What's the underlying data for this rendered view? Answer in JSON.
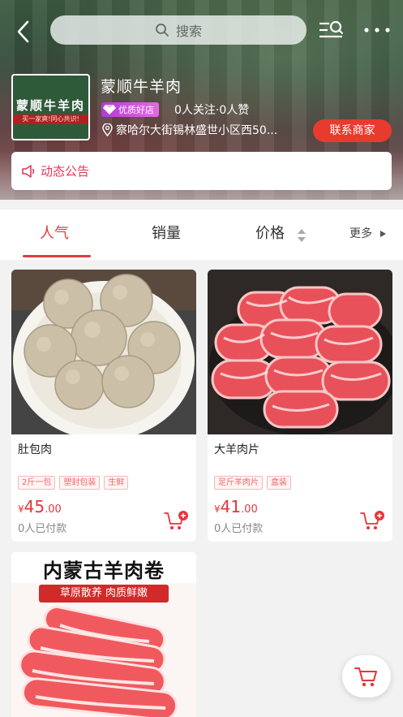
{
  "header": {
    "search_placeholder": "搜索",
    "icons": {
      "back": "chevron-left-icon",
      "search": "search-icon",
      "list_search": "list-search-icon",
      "more": "more-dots-icon"
    }
  },
  "shop": {
    "name": "蒙顺牛羊肉",
    "logo_text": "蒙顺牛羊肉",
    "logo_slogan": "买一家爽!同心共识!",
    "badge": "优质好店",
    "stats": "0人关注·0人赞",
    "address": "察哈尔大街锡林盛世小区西50...",
    "contact_label": "联系商家",
    "notice": "动态公告"
  },
  "sort": {
    "tabs": [
      {
        "label": "人气",
        "active": true
      },
      {
        "label": "销量",
        "active": false
      },
      {
        "label": "价格",
        "active": false
      }
    ],
    "more_label": "更多"
  },
  "products": [
    {
      "name": "肚包肉",
      "tags": [
        "2斤一包",
        "塑封包装",
        "生鲜"
      ],
      "price_currency": "¥",
      "price_int": "45",
      "price_dec": ".00",
      "paid": "0人已付款"
    },
    {
      "name": "大羊肉片",
      "tags": [
        "足斤羊肉片",
        "盒装"
      ],
      "price_currency": "¥",
      "price_int": "41",
      "price_dec": ".00",
      "paid": "0人已付款"
    },
    {
      "image_title": "内蒙古羊肉卷",
      "image_subtitle": "草原散养 肉质鲜嫩"
    }
  ],
  "colors": {
    "accent": "#e03c3c",
    "contact": "#e83a2e",
    "price": "#e8343a",
    "badge": "#b13ad6",
    "notice": "#e8345a"
  }
}
